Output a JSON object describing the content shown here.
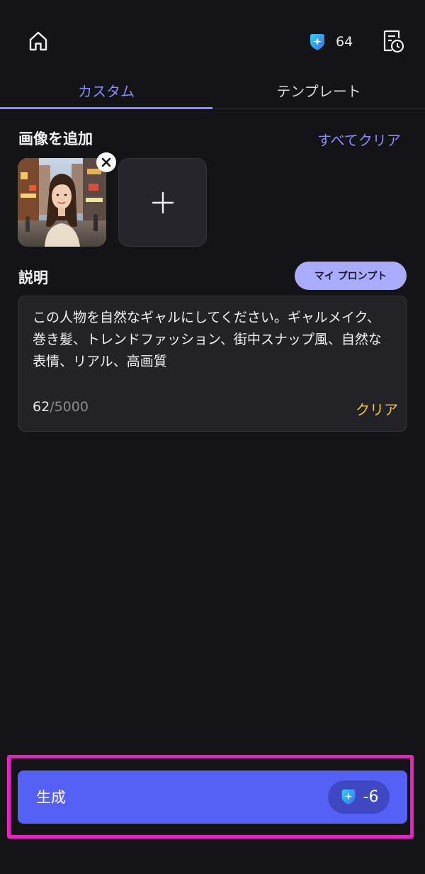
{
  "header": {
    "credits": "64",
    "icons": {
      "home": "home-icon",
      "gem": "gem-icon",
      "history": "history-icon"
    }
  },
  "tabs": [
    {
      "label": "カスタム",
      "active": true
    },
    {
      "label": "テンプレート",
      "active": false
    }
  ],
  "images": {
    "title": "画像を追加",
    "clear_all": "すべてクリア"
  },
  "description": {
    "title": "説明",
    "my_prompt_label": "マイ プロンプト",
    "text": "この人物を自然なギャルにしてください。ギャルメイク、巻き髪、トレンドファッション、街中スナップ風、自然な表情、リアル、高画質",
    "count_current": "62",
    "count_max": "/5000",
    "clear_label": "クリア"
  },
  "generate": {
    "label": "生成",
    "cost": "-6"
  },
  "colors": {
    "accent": "#8b8cff",
    "button": "#5560f6",
    "clear": "#f3c443",
    "highlight": "#f21dc8"
  }
}
